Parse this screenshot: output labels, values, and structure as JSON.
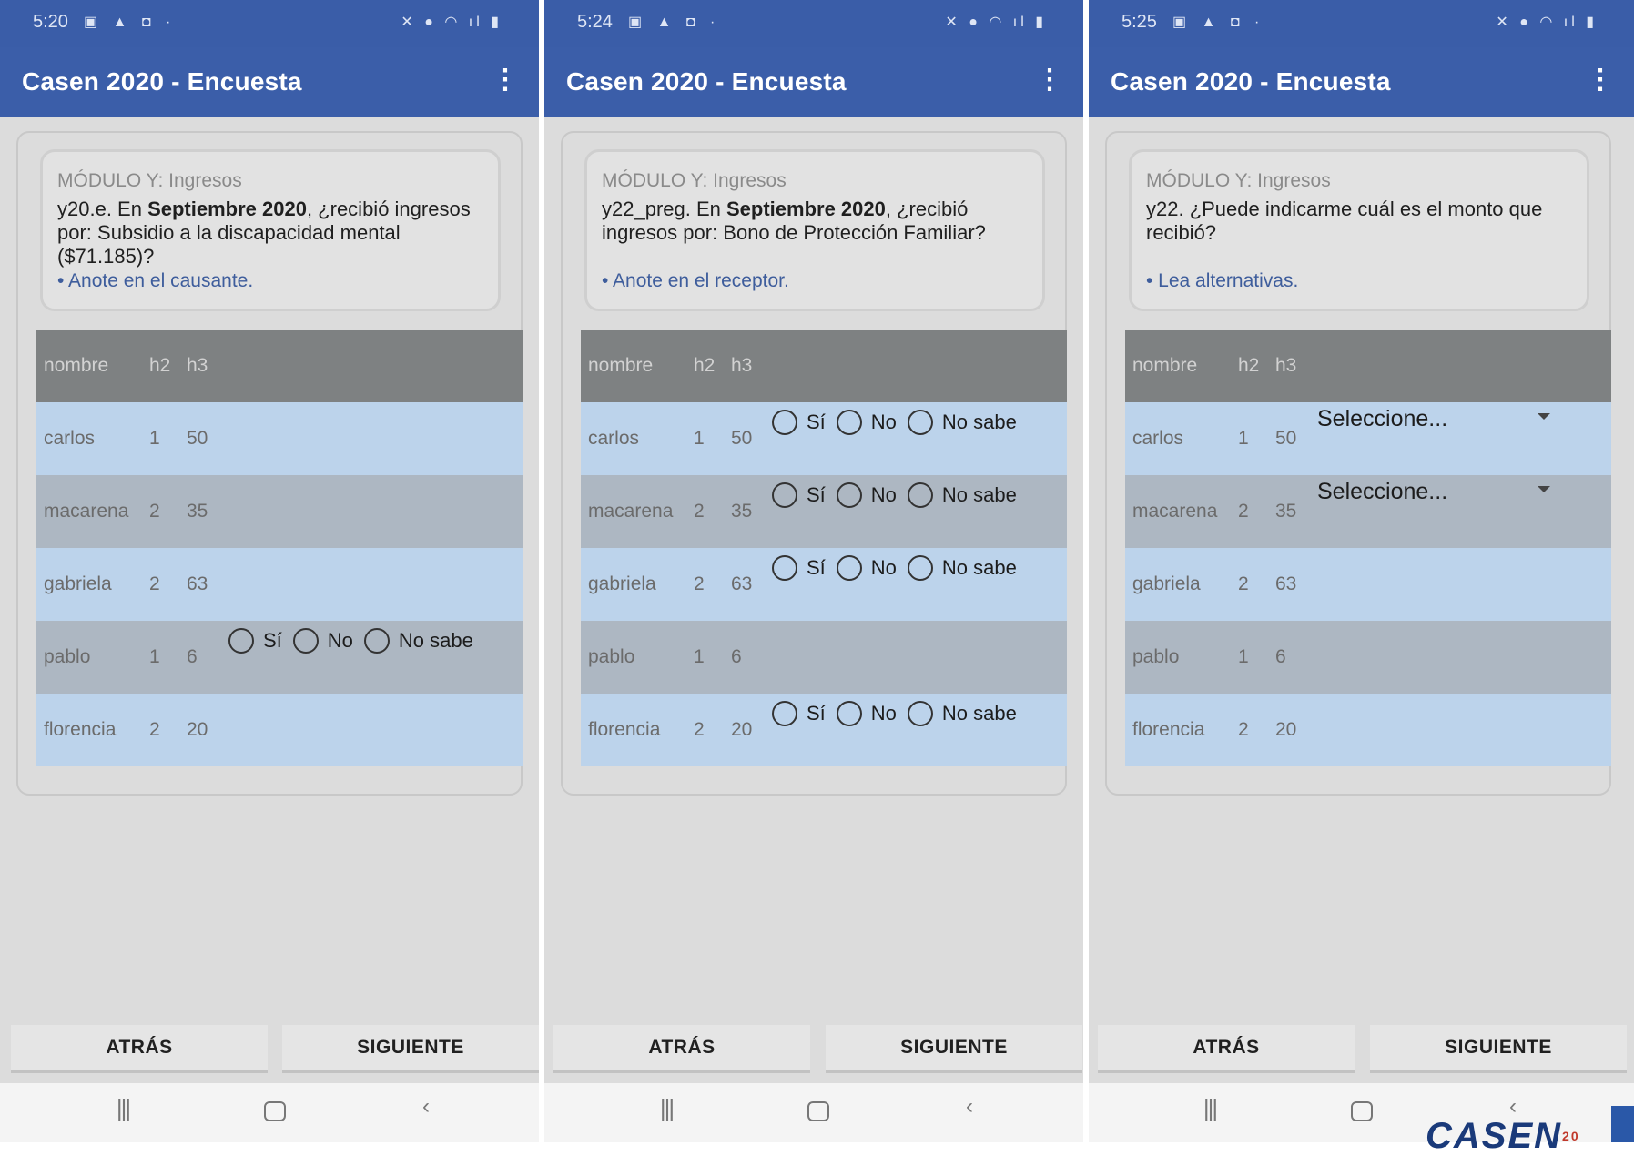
{
  "screens": [
    {
      "status": {
        "time": "5:20"
      },
      "appbar": {
        "title": "Casen 2020 - Encuesta"
      },
      "question": {
        "module": "MÓDULO Y: Ingresos",
        "code": "y20.e. En ",
        "bold": "Septiembre 2020",
        "rest": ", ¿recibió ingresos por: Subsidio a la discapacidad mental ($71.185)?",
        "note": "• Anote en el causante."
      },
      "header": {
        "name": "nombre",
        "h2": "h2",
        "h3": "h3"
      },
      "rows": [
        {
          "name": "carlos",
          "h2": "1",
          "h3": "50"
        },
        {
          "name": "macarena",
          "h2": "2",
          "h3": "35"
        },
        {
          "name": "gabriela",
          "h2": "2",
          "h3": "63"
        },
        {
          "name": "pablo",
          "h2": "1",
          "h3": "6"
        },
        {
          "name": "florencia",
          "h2": "2",
          "h3": "20"
        }
      ],
      "options": {
        "si": "Sí",
        "no": "No",
        "nosabe": "No sabe"
      },
      "buttons": {
        "back": "ATRÁS",
        "next": "SIGUIENTE"
      }
    },
    {
      "status": {
        "time": "5:24"
      },
      "appbar": {
        "title": "Casen 2020 - Encuesta"
      },
      "question": {
        "module": "MÓDULO Y: Ingresos",
        "code": "y22_preg. En ",
        "bold": "Septiembre 2020",
        "rest": ", ¿recibió ingresos por: Bono de Protección Familiar?",
        "note": "• Anote en el receptor."
      },
      "header": {
        "name": "nombre",
        "h2": "h2",
        "h3": "h3"
      },
      "rows": [
        {
          "name": "carlos",
          "h2": "1",
          "h3": "50"
        },
        {
          "name": "macarena",
          "h2": "2",
          "h3": "35"
        },
        {
          "name": "gabriela",
          "h2": "2",
          "h3": "63"
        },
        {
          "name": "pablo",
          "h2": "1",
          "h3": "6"
        },
        {
          "name": "florencia",
          "h2": "2",
          "h3": "20"
        }
      ],
      "options": {
        "si": "Sí",
        "no": "No",
        "nosabe": "No sabe"
      },
      "buttons": {
        "back": "ATRÁS",
        "next": "SIGUIENTE"
      }
    },
    {
      "status": {
        "time": "5:25"
      },
      "appbar": {
        "title": "Casen 2020 - Encuesta"
      },
      "question": {
        "module": "MÓDULO Y: Ingresos",
        "code": "y22. ¿Puede indicarme cuál es el monto que recibió?",
        "bold": "",
        "rest": "",
        "note": "• Lea alternativas."
      },
      "header": {
        "name": "nombre",
        "h2": "h2",
        "h3": "h3"
      },
      "rows": [
        {
          "name": "carlos",
          "h2": "1",
          "h3": "50"
        },
        {
          "name": "macarena",
          "h2": "2",
          "h3": "35"
        },
        {
          "name": "gabriela",
          "h2": "2",
          "h3": "63"
        },
        {
          "name": "pablo",
          "h2": "1",
          "h3": "6"
        },
        {
          "name": "florencia",
          "h2": "2",
          "h3": "20"
        }
      ],
      "select": {
        "placeholder": "Seleccione..."
      },
      "buttons": {
        "back": "ATRÁS",
        "next": "SIGUIENTE"
      }
    }
  ],
  "brand": {
    "text": "CASEN",
    "sup": "20"
  },
  "icons": {
    "menu": "more-vert-icon",
    "nav_recent": "recent-apps-icon",
    "nav_home": "home-icon",
    "nav_back": "back-icon"
  },
  "colors": {
    "appbar": "#3b5ea9",
    "row_light": "#bcd3eb",
    "row_dark": "#adb7c2",
    "header_row": "#7e8182",
    "note": "#3e5d9c"
  }
}
